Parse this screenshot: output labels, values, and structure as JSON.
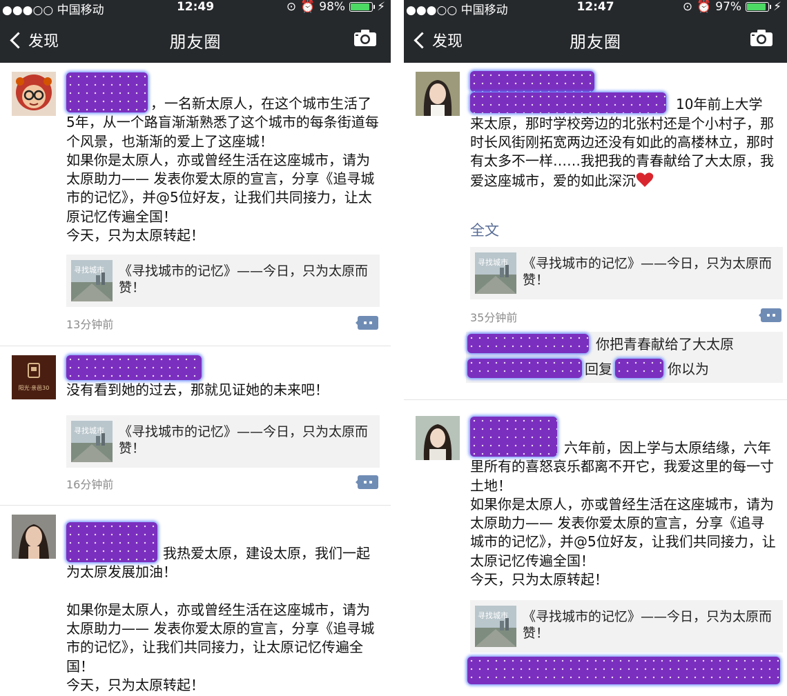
{
  "left": {
    "status": {
      "carrier": "●●●○○ 中国移动",
      "time": "12:49",
      "battery": "98%",
      "battery_fill": 0.98
    },
    "nav": {
      "back": "发现",
      "title": "朋友圈"
    },
    "posts": [
      {
        "text": "，一名新太原人，在这个城市生活了5年，从一个路盲渐渐熟悉了这个城市的每条街道每个风景，也渐渐的爱上了这座城！\n如果你是太原人，亦或曾经生活在这座城市，请为太原助力—— 发表你爱太原的宣言，分享《追寻城市的记忆》，并@5位好友，让我们共同接力，让太原记忆传遍全国！\n今天，只为太原转起！",
        "link": "《寻找城市的记忆》——今日，只为太原而赞！",
        "time": "13分钟前"
      },
      {
        "text": "没有看到她的过去，那就见证她的未来吧！",
        "link": "《寻找城市的记忆》——今日，只为太原而赞！",
        "time": "16分钟前"
      },
      {
        "text": "我热爱太原，建设太原，我们一起为太原发展加油！\n\n如果你是太原人，亦或曾经生活在这座城市，请为太原助力—— 发表你爱太原的宣言，分享《追寻城市的记忆》，让我们共同接力，让太原记忆传遍全国！\n今天，只为太原转起！"
      }
    ]
  },
  "right": {
    "status": {
      "carrier": "●●●○○ 中国移动",
      "time": "12:47",
      "battery": "97%",
      "battery_fill": 0.97
    },
    "nav": {
      "back": "发现",
      "title": "朋友圈"
    },
    "posts": [
      {
        "text_first": "10年前上大学",
        "text_rest": "来太原，那时学校旁边的北张村还是个小村子，那时长风街刚拓宽两边还没有如此的高楼林立，那时有太多不一样……我把我的青春献给了大太原，我爱这座城市，爱的如此深沉",
        "full_text": "全文",
        "link": "《寻找城市的记忆》——今日，只为太原而赞！",
        "time": "35分钟前",
        "comments": [
          {
            "text": "你把青春献给了大太原"
          },
          {
            "reply_word": "回复",
            "text": "你以为"
          }
        ]
      },
      {
        "text": "六年前，因上学与太原结缘，六年里所有的喜怒哀乐都离不开它，我爱这里的每一寸土地！\n如果你是太原人，亦或曾经生活在这座城市，请为太原助力—— 发表你爱太原的宣言，分享《追寻城市的记忆》，并@5位好友，让我们共同接力，让太原记忆传遍全国！\n今天，只为太原转起！",
        "link": "《寻找城市的记忆》——今日，只为太原而赞！"
      }
    ]
  },
  "avatar_brand_text": "阳光·亲邑30",
  "thumb_text": "寻找城市",
  "colors": {
    "topbar": "#26292c",
    "link_blue": "#576b95",
    "redact": "#7b2fbe",
    "card_bg": "#f2f2f2"
  }
}
